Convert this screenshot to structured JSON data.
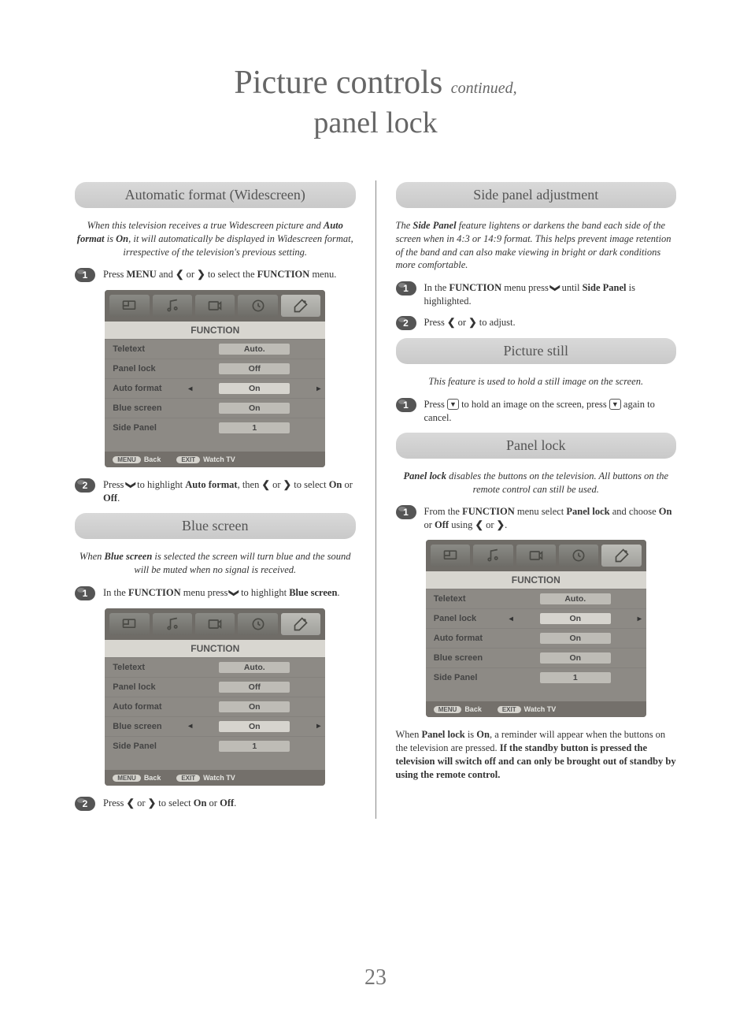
{
  "page": {
    "title_main": "Picture controls",
    "title_cont": "continued,",
    "title_sub": "panel lock",
    "number": "23"
  },
  "glyphs": {
    "left": "❮",
    "right": "❯",
    "down": "❯"
  },
  "left": {
    "auto_format": {
      "heading": "Automatic format (Widescreen)",
      "intro_pre": "When this television receives a true Widescreen picture and ",
      "intro_b1": "Auto format",
      "intro_mid": " is ",
      "intro_b2": "On",
      "intro_post": ", it will automatically be displayed in Widescreen format, irrespective of the television's previous setting.",
      "step1_pre": "Press ",
      "step1_b1": "MENU",
      "step1_mid1": " and ",
      "step1_mid2": " or ",
      "step1_mid3": " to select the ",
      "step1_b2": "FUNCTION",
      "step1_post": " menu.",
      "step2_pre": "Press ",
      "step2_mid1": " to highlight ",
      "step2_b1": "Auto format",
      "step2_mid2": ", then ",
      "step2_mid3": " or ",
      "step2_mid4": " to select ",
      "step2_b2": "On",
      "step2_mid5": " or ",
      "step2_b3": "Off",
      "step2_post": "."
    },
    "blue_screen": {
      "heading": "Blue screen",
      "intro_pre": "When ",
      "intro_b1": "Blue screen",
      "intro_post": " is selected the screen will turn blue and the sound will be muted when no signal is received.",
      "step1_pre": "In the ",
      "step1_b1": "FUNCTION",
      "step1_mid1": " menu press ",
      "step1_mid2": " to highlight ",
      "step1_b2": "Blue screen",
      "step1_post": ".",
      "step2_pre": "Press ",
      "step2_mid1": " or ",
      "step2_mid2": " to select ",
      "step2_b1": "On",
      "step2_mid3": " or ",
      "step2_b2": "Off",
      "step2_post": "."
    }
  },
  "right": {
    "side_panel": {
      "heading": "Side panel adjustment",
      "intro_pre": "The ",
      "intro_b1": "Side Panel",
      "intro_post": " feature lightens or darkens the band each side of the screen when in 4:3 or 14:9 format. This helps prevent image retention of the band and can also make viewing in bright or dark conditions more comfortable.",
      "step1_pre": "In the ",
      "step1_b1": "FUNCTION",
      "step1_mid1": " menu press ",
      "step1_mid2": " until ",
      "step1_b2": "Side Panel",
      "step1_post": " is highlighted.",
      "step2_pre": "Press ",
      "step2_mid1": " or ",
      "step2_post": " to adjust."
    },
    "picture_still": {
      "heading": "Picture still",
      "intro": "This feature is used to hold a still image on the screen.",
      "step1_pre": "Press ",
      "step1_mid1": " to hold an image on the screen, press ",
      "step1_post": " again to cancel."
    },
    "panel_lock": {
      "heading": "Panel lock",
      "intro_b1": "Panel lock",
      "intro_post": " disables the buttons on the television. All buttons on the remote control can still be used.",
      "step1_pre": "From the ",
      "step1_b1": "FUNCTION",
      "step1_mid1": " menu select ",
      "step1_b2": "Panel lock",
      "step1_mid2": " and choose ",
      "step1_b3": "On",
      "step1_mid3": " or ",
      "step1_b4": "Off",
      "step1_mid4": " using ",
      "step1_mid5": " or ",
      "step1_post": ".",
      "note_pre": "When ",
      "note_b1": "Panel lock",
      "note_mid1": " is ",
      "note_b2": "On",
      "note_mid2": ", a reminder will appear when the buttons on the television are pressed. ",
      "note_b3": "If the standby button is pressed the television will switch off and can only be brought out of standby by using the remote control."
    }
  },
  "osd": {
    "title": "FUNCTION",
    "footer_menu": "MENU",
    "footer_back": "Back",
    "footer_exit": "EXIT",
    "footer_watch": "Watch TV",
    "menu1": {
      "rows": [
        {
          "label": "Teletext",
          "value": "Auto.",
          "selected": false
        },
        {
          "label": "Panel lock",
          "value": "Off",
          "selected": false
        },
        {
          "label": "Auto format",
          "value": "On",
          "selected": true
        },
        {
          "label": "Blue screen",
          "value": "On",
          "selected": false
        },
        {
          "label": "Side Panel",
          "value": "1",
          "selected": false
        }
      ]
    },
    "menu2": {
      "rows": [
        {
          "label": "Teletext",
          "value": "Auto.",
          "selected": false
        },
        {
          "label": "Panel lock",
          "value": "Off",
          "selected": false
        },
        {
          "label": "Auto format",
          "value": "On",
          "selected": false
        },
        {
          "label": "Blue screen",
          "value": "On",
          "selected": true
        },
        {
          "label": "Side Panel",
          "value": "1",
          "selected": false
        }
      ]
    },
    "menu3": {
      "rows": [
        {
          "label": "Teletext",
          "value": "Auto.",
          "selected": false
        },
        {
          "label": "Panel lock",
          "value": "On",
          "selected": true
        },
        {
          "label": "Auto format",
          "value": "On",
          "selected": false
        },
        {
          "label": "Blue screen",
          "value": "On",
          "selected": false
        },
        {
          "label": "Side Panel",
          "value": "1",
          "selected": false
        }
      ]
    }
  }
}
